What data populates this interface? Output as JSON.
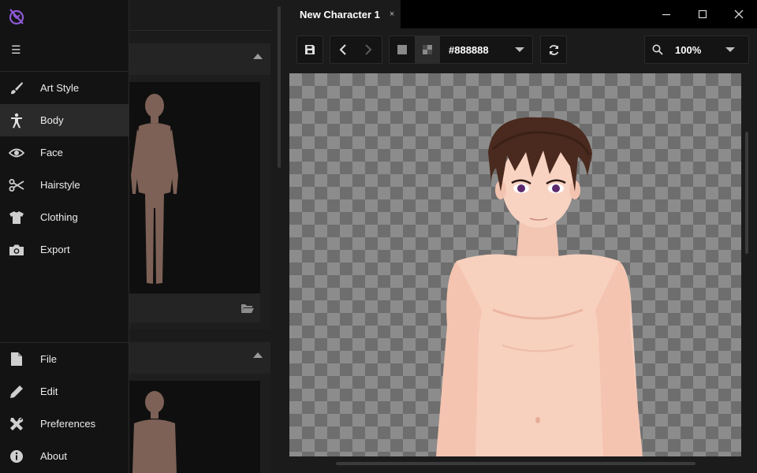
{
  "app": {
    "accent": "#8f5ad6"
  },
  "nav": {
    "menu_icon": "hamburger-icon",
    "items": [
      {
        "label": "Art Style",
        "icon": "brush-icon"
      },
      {
        "label": "Body",
        "icon": "person-icon",
        "active": true
      },
      {
        "label": "Face",
        "icon": "eye-icon"
      },
      {
        "label": "Hairstyle",
        "icon": "scissors-icon"
      },
      {
        "label": "Clothing",
        "icon": "tshirt-icon"
      },
      {
        "label": "Export",
        "icon": "camera-icon"
      }
    ],
    "bottom_items": [
      {
        "label": "File",
        "icon": "file-icon"
      },
      {
        "label": "Edit",
        "icon": "pencil-icon"
      },
      {
        "label": "Preferences",
        "icon": "tools-icon"
      },
      {
        "label": "About",
        "icon": "info-icon"
      }
    ]
  },
  "tabs": [
    {
      "title": "New Character 1",
      "close": "×"
    }
  ],
  "toolbar": {
    "background_color": "#888888",
    "zoom": "100%"
  }
}
